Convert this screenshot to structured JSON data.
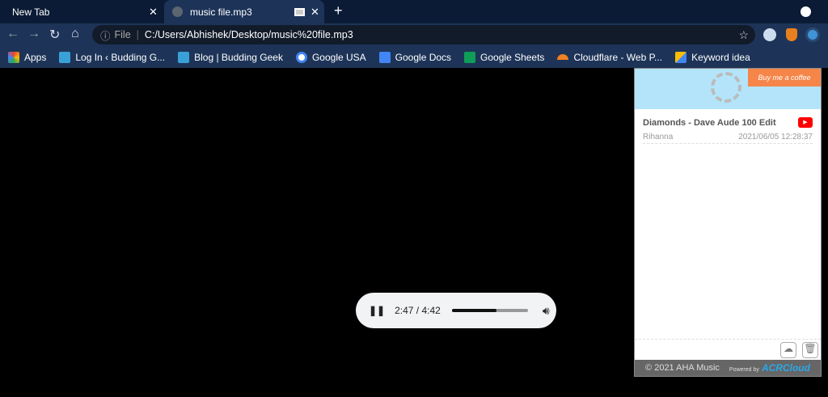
{
  "tabs": [
    {
      "title": "New Tab"
    },
    {
      "title": "music file.mp3"
    }
  ],
  "omnibox": {
    "scheme_label": "File",
    "url": "C:/Users/Abhishek/Desktop/music%20file.mp3"
  },
  "bookmarks": [
    {
      "label": "Apps",
      "icon": "apps-grid-icon",
      "color": "#e94235"
    },
    {
      "label": "Log In ‹ Budding G...",
      "icon": "budding-geek-icon",
      "color": "#3aa0d8"
    },
    {
      "label": "Blog | Budding Geek",
      "icon": "budding-geek-icon",
      "color": "#3aa0d8"
    },
    {
      "label": "Google USA",
      "icon": "google-icon",
      "color": "#ffffff"
    },
    {
      "label": "Google Docs",
      "icon": "google-docs-icon",
      "color": "#4285f4"
    },
    {
      "label": "Google Sheets",
      "icon": "google-sheets-icon",
      "color": "#0f9d58"
    },
    {
      "label": "Cloudflare - Web P...",
      "icon": "cloudflare-icon",
      "color": "#f38020"
    },
    {
      "label": "Keyword idea",
      "icon": "google-ads-icon",
      "color": "#fbbc04"
    }
  ],
  "popup": {
    "coffee_label": "Buy me a coffee",
    "song": {
      "title": "Diamonds - Dave Aude 100 Edit",
      "artist": "Rihanna",
      "timestamp": "2021/06/05 12:28:37"
    },
    "footer": {
      "copyright": "© 2021 AHA Music",
      "powered": "Powered by",
      "brand": "ACRCloud"
    }
  },
  "player": {
    "time": "2:47 / 4:42",
    "progress": 0.59
  }
}
